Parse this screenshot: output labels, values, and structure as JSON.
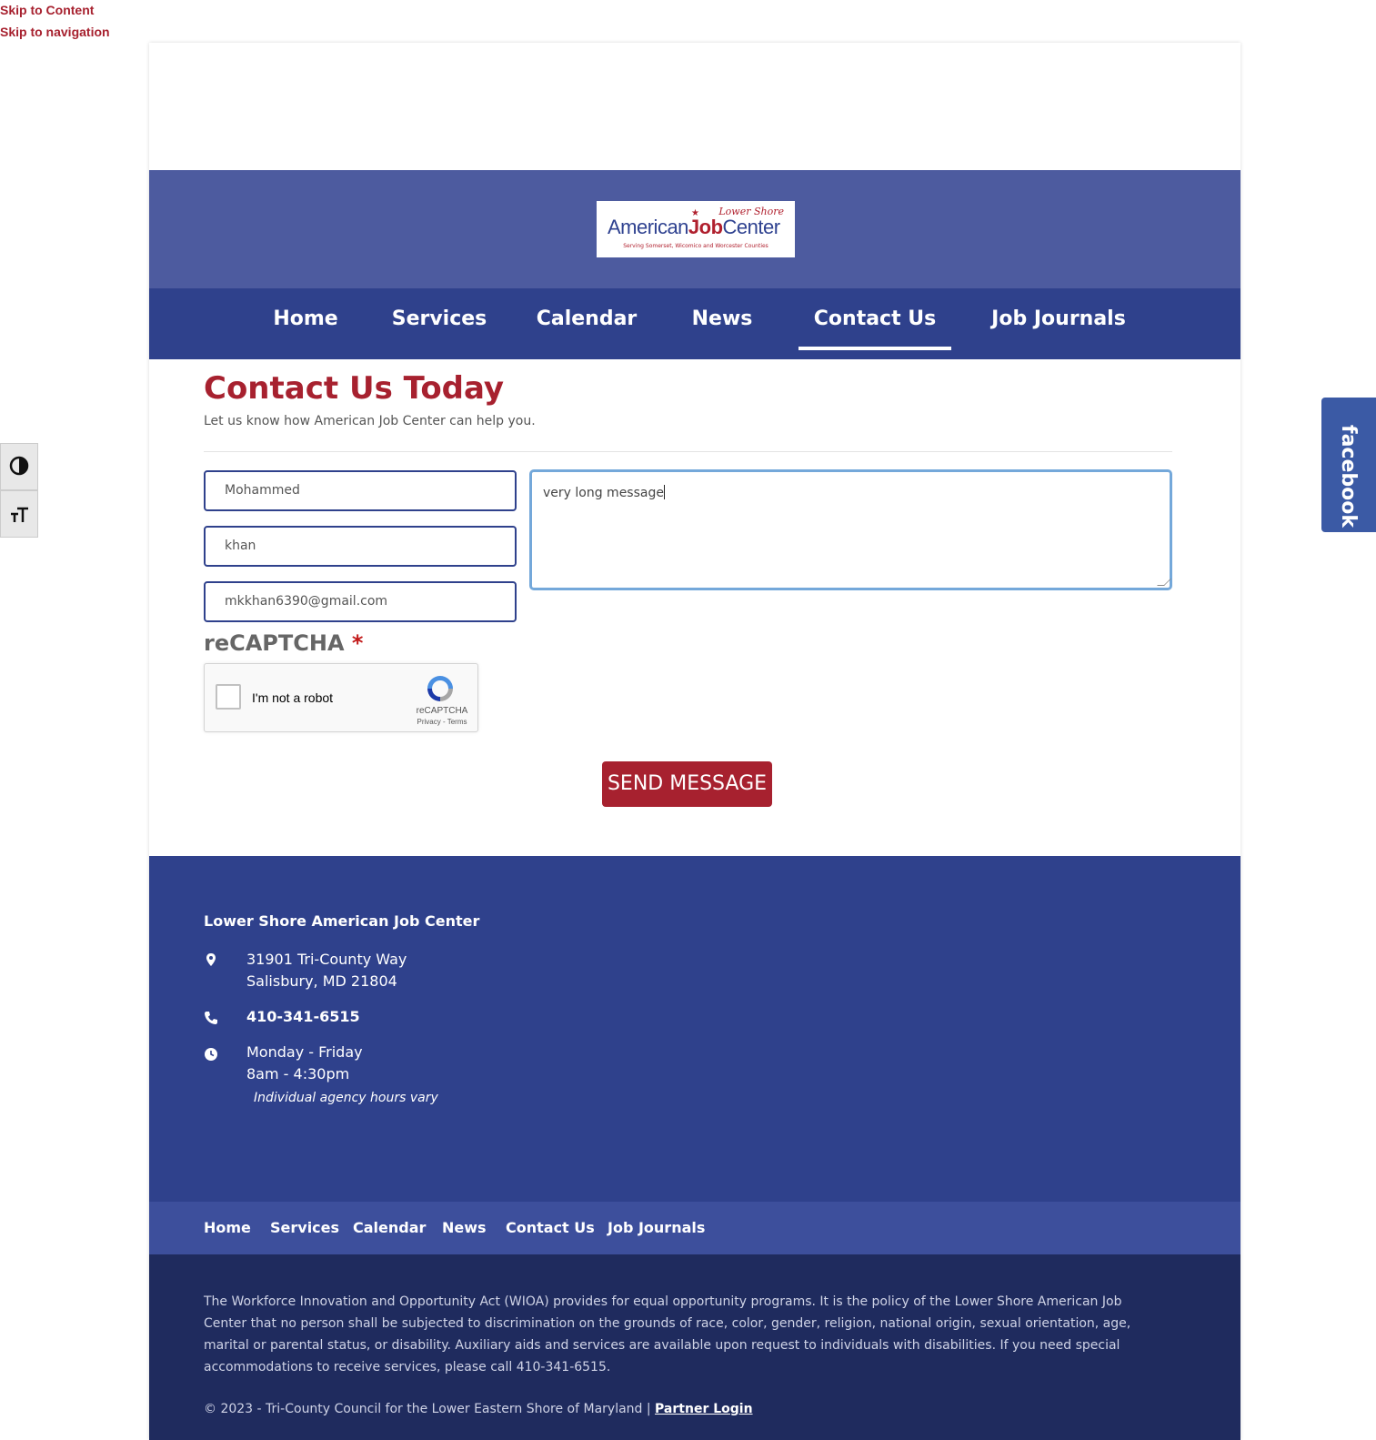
{
  "skip_links": {
    "content": "Skip to Content",
    "navigation": "Skip to navigation"
  },
  "logo": {
    "lower_shore": "Lower Shore",
    "american": "American",
    "job": "Job",
    "center": "Center",
    "tagline": "Serving Somerset, Wicomico and Worcester Counties"
  },
  "nav": {
    "items": [
      {
        "label": "Home"
      },
      {
        "label": "Services"
      },
      {
        "label": "Calendar"
      },
      {
        "label": "News"
      },
      {
        "label": "Contact Us"
      },
      {
        "label": "Job Journals"
      }
    ],
    "active": "Contact Us"
  },
  "contact": {
    "title": "Contact Us Today",
    "subtitle": "Let us know how American Job Center can help you.",
    "first_name": "Mohammed",
    "last_name": "khan",
    "email": "mkkhan6390@gmail.com",
    "message": "very long message",
    "recaptcha_label": "reCAPTCHA",
    "required_marker": "*",
    "recaptcha_checkbox_text": "I'm not a robot",
    "recaptcha_brand": "reCAPTCHA",
    "recaptcha_terms": "Privacy - Terms",
    "send_label": "SEND MESSAGE"
  },
  "footer": {
    "org_name": "Lower Shore American Job Center",
    "address_line1": "31901 Tri-County Way",
    "address_line2": "Salisbury, MD 21804",
    "phone": "410-341-6515",
    "hours_days": "Monday - Friday",
    "hours_time": "8am - 4:30pm",
    "hours_note": "Individual agency hours vary"
  },
  "footer_nav": {
    "items": [
      {
        "label": "Home"
      },
      {
        "label": "Services"
      },
      {
        "label": "Calendar"
      },
      {
        "label": "News"
      },
      {
        "label": "Contact Us"
      },
      {
        "label": "Job Journals"
      }
    ]
  },
  "legal": {
    "text": "The Workforce Innovation and Opportunity Act (WIOA) provides for equal opportunity programs. It is the policy of the Lower Shore American Job Center that no person shall be subjected to discrimination on the grounds of race, color, gender, religion, national origin, sexual orientation, age, marital or parental status, or disability. Auxiliary aids and services are available upon request to individuals with disabilities. If you need special accommodations to receive services, please call 410-341-6515.",
    "copyright": "© 2023 - Tri-County Council for the Lower Eastern Shore of Maryland |",
    "partner_login": "Partner Login"
  },
  "social": {
    "facebook_label": "facebook"
  },
  "colors": {
    "brand_red": "#a7212f",
    "nav_blue": "#2f418c",
    "brand_bar": "#4d5b9f",
    "legal_bg": "#1f2b5e",
    "focus_blue": "#74a8da"
  },
  "icons": {
    "contrast": "contrast-icon",
    "text_size": "text-size-icon",
    "location": "map-pin-icon",
    "phone": "phone-icon",
    "clock": "clock-icon"
  }
}
